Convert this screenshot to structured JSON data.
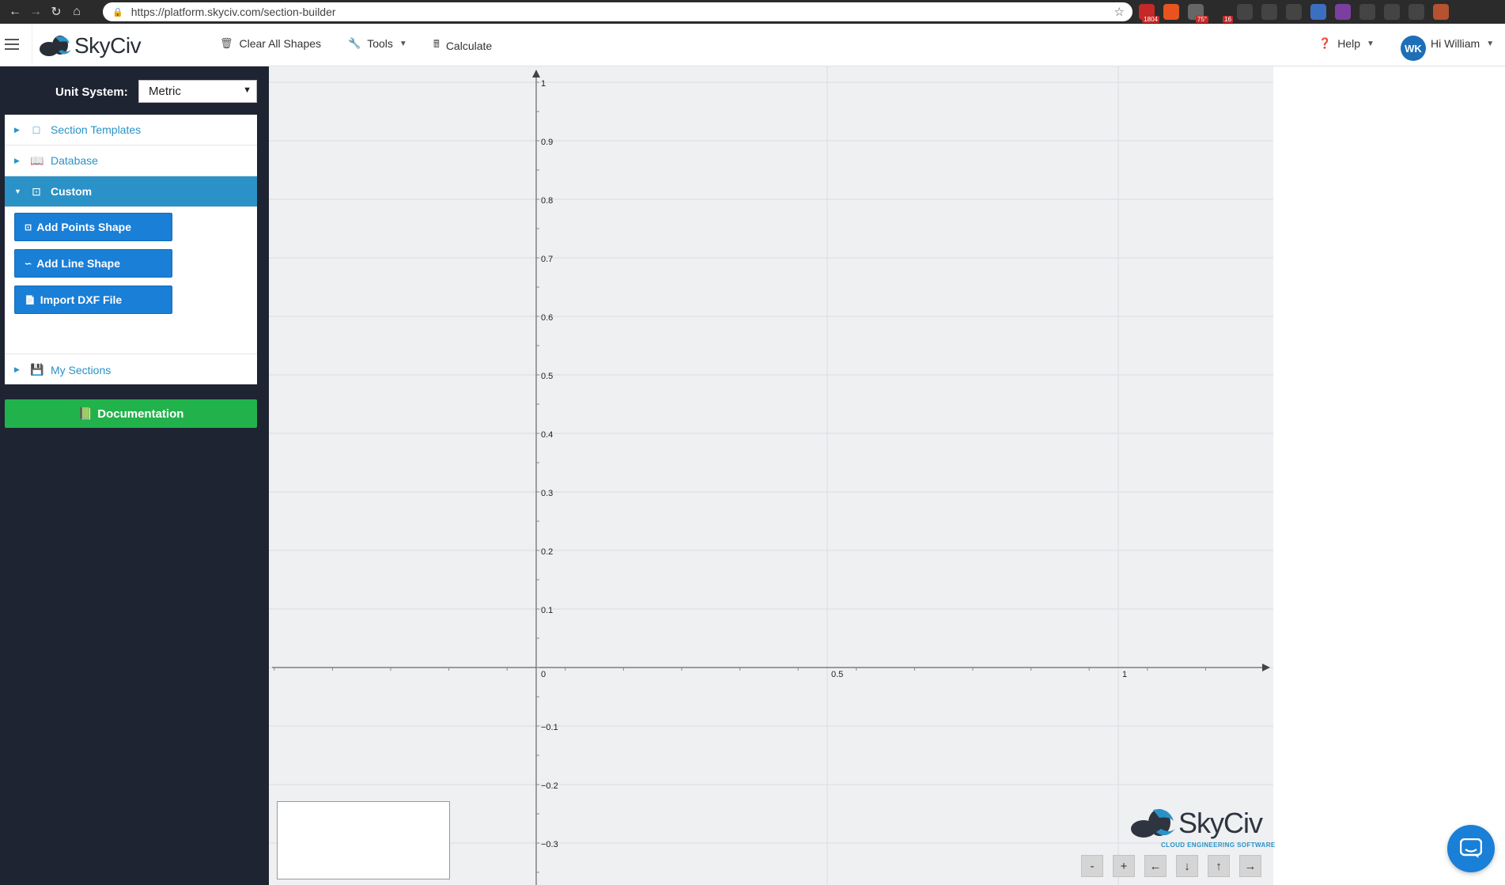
{
  "browser": {
    "url": "https://platform.skyciv.com/section-builder",
    "extensions": [
      {
        "name": "gmail-ext-icon",
        "color": "#c62828",
        "badge": "1804"
      },
      {
        "name": "shield-ext-icon",
        "color": "#e8541e",
        "badge": ""
      },
      {
        "name": "weather-ext-icon",
        "color": "#666666",
        "badge": "75°"
      },
      {
        "name": "cloud-ext-icon",
        "color": "#2b2b2b",
        "badge": "16"
      },
      {
        "name": "c-ext-icon",
        "color": "#444444",
        "badge": ""
      },
      {
        "name": "circle-ext-icon",
        "color": "#444444",
        "badge": ""
      },
      {
        "name": "block-ext-icon",
        "color": "#444444",
        "badge": ""
      },
      {
        "name": "bookmark-ext-icon",
        "color": "#3b6fc2",
        "badge": ""
      },
      {
        "name": "onenote-ext-icon",
        "color": "#7b3fa0",
        "badge": ""
      },
      {
        "name": "react-ext-icon",
        "color": "#444444",
        "badge": ""
      },
      {
        "name": "target-ext-icon",
        "color": "#444444",
        "badge": ""
      },
      {
        "name": "arrow-ext-icon",
        "color": "#444444",
        "badge": ""
      },
      {
        "name": "profile-ext-icon",
        "color": "#b5522f",
        "badge": ""
      }
    ]
  },
  "header": {
    "brand": "SkyCiv",
    "menu": {
      "clear_all": "Clear All Shapes",
      "tools": "Tools",
      "calculate": "Calculate",
      "help": "Help",
      "user_greeting": "Hi William",
      "user_initials": "WK"
    }
  },
  "sidebar": {
    "unit_label": "Unit System:",
    "unit_value": "Metric",
    "accordion": {
      "section_templates": "Section Templates",
      "database": "Database",
      "custom": "Custom",
      "my_sections": "My Sections"
    },
    "custom_buttons": {
      "add_points": "Add Points Shape",
      "add_line": "Add Line Shape",
      "import_dxf": "Import DXF File"
    },
    "documentation": "Documentation"
  },
  "canvas": {
    "y_labels": [
      "1",
      "0.9",
      "0.8",
      "0.7",
      "0.6",
      "0.5",
      "0.4",
      "0.3",
      "0.2",
      "0.1",
      "0",
      "−0.1",
      "−0.2",
      "−0.3"
    ],
    "x_labels": [
      "0.5",
      "1"
    ],
    "watermark": "SkyCiv",
    "watermark_sub": "CLOUD ENGINEERING SOFTWARE",
    "controls": [
      "-",
      "+",
      "←",
      "↓",
      "↑",
      "→"
    ],
    "grid_color": "#d9dde1",
    "bg_color": "#eef0f2"
  },
  "colors": {
    "sidebar_bg": "#1e2432",
    "accent_blue": "#2a92c7",
    "button_blue": "#1a7fd6",
    "doc_green": "#22b24c"
  }
}
